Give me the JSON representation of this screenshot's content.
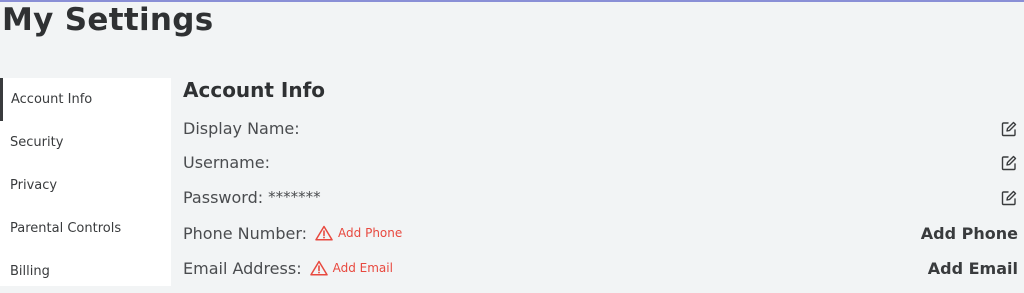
{
  "page": {
    "title": "My Settings"
  },
  "sidebar": {
    "items": [
      {
        "label": "Account Info"
      },
      {
        "label": "Security"
      },
      {
        "label": "Privacy"
      },
      {
        "label": "Parental Controls"
      },
      {
        "label": "Billing"
      }
    ]
  },
  "account": {
    "section_title": "Account Info",
    "display_name_label": "Display Name:",
    "username_label": "Username:",
    "password_label": "Password:",
    "password_value": "*******",
    "phone_label": "Phone Number:",
    "phone_link": "Add Phone",
    "phone_action": "Add Phone",
    "email_label": "Email Address:",
    "email_link": "Add Email",
    "email_action": "Add Email"
  },
  "icons": {
    "edit": "edit-icon",
    "warning": "warning-icon"
  },
  "colors": {
    "warning": "#e8493f",
    "top_accent": "#8a8fd6",
    "background": "#f2f4f5"
  }
}
